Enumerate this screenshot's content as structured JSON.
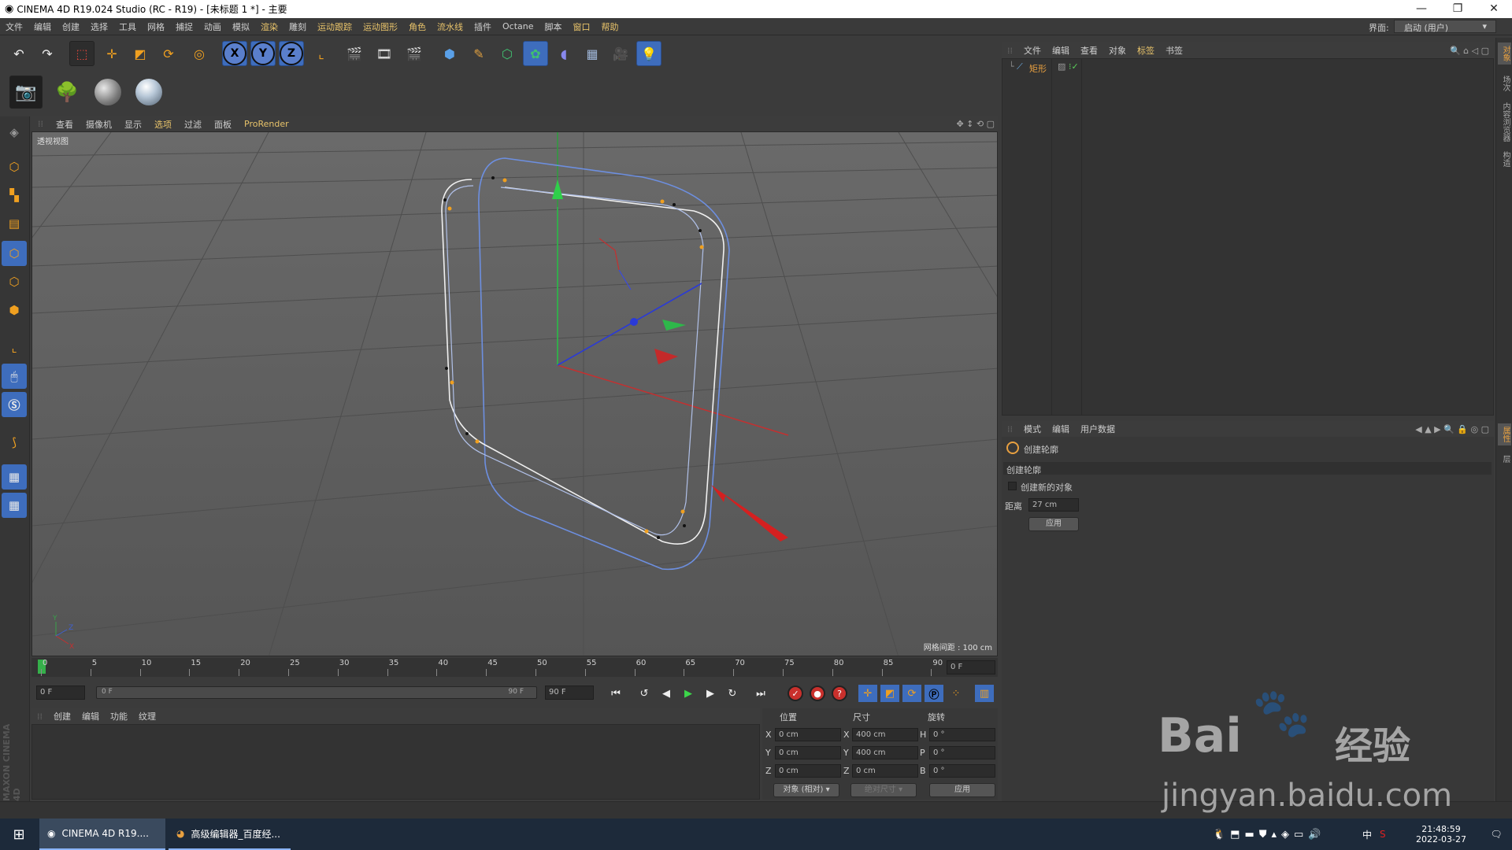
{
  "window": {
    "title": "CINEMA 4D R19.024 Studio (RC - R19) - [未标题 1 *] - 主要",
    "controls": [
      "—",
      "❐",
      "✕"
    ]
  },
  "menubar": {
    "items": [
      "文件",
      "编辑",
      "创建",
      "选择",
      "工具",
      "网格",
      "捕捉",
      "动画",
      "模拟",
      "渲染",
      "雕刻",
      "运动跟踪",
      "运动图形",
      "角色",
      "流水线",
      "插件",
      "Octane",
      "脚本",
      "窗口",
      "帮助"
    ],
    "layout_label": "界面:",
    "layout_value": "启动 (用户)"
  },
  "viewport": {
    "menu": [
      "查看",
      "摄像机",
      "显示",
      "选项",
      "过滤",
      "面板",
      "ProRender"
    ],
    "label": "透视视图",
    "grid_spacing": "网格间距 : 100 cm"
  },
  "timeline": {
    "ticks": [
      "0",
      "5",
      "10",
      "15",
      "20",
      "25",
      "30",
      "35",
      "40",
      "45",
      "50",
      "55",
      "60",
      "65",
      "70",
      "75",
      "80",
      "85",
      "90"
    ],
    "current_frame": "0 F",
    "start_field": "0 F",
    "range_start": "0 F",
    "range_end": "90 F",
    "end_field": "90 F"
  },
  "material_manager": {
    "menu": [
      "创建",
      "编辑",
      "功能",
      "纹理"
    ]
  },
  "coordinates": {
    "headers": [
      "位置",
      "尺寸",
      "旋转"
    ],
    "rows": [
      {
        "pos_label": "X",
        "pos": "0 cm",
        "size_label": "X",
        "size": "400 cm",
        "rot_label": "H",
        "rot": "0 °"
      },
      {
        "pos_label": "Y",
        "pos": "0 cm",
        "size_label": "Y",
        "size": "400 cm",
        "rot_label": "P",
        "rot": "0 °"
      },
      {
        "pos_label": "Z",
        "pos": "0 cm",
        "size_label": "Z",
        "size": "0 cm",
        "rot_label": "B",
        "rot": "0 °"
      }
    ],
    "mode": "对象 (相对)",
    "size_mode": "绝对尺寸",
    "apply": "应用"
  },
  "object_manager": {
    "menu": [
      "文件",
      "编辑",
      "查看",
      "对象",
      "标签",
      "书签"
    ],
    "object_name": "矩形"
  },
  "attribute_manager": {
    "menu": [
      "模式",
      "编辑",
      "用户数据"
    ],
    "tool_name": "创建轮廓",
    "section": "创建轮廓",
    "checkbox_label": "创建新的对象",
    "distance_label": "距离",
    "distance_value": "27 cm",
    "apply": "应用"
  },
  "right_tabs": [
    "对象",
    "场次",
    "内容浏览器",
    "构造"
  ],
  "right_tabs2": [
    "属性",
    "层"
  ],
  "taskbar": {
    "apps": [
      {
        "label": "CINEMA 4D R19...."
      },
      {
        "label": "高级编辑器_百度经..."
      }
    ],
    "time": "21:48:59",
    "date": "2022-03-27",
    "ime": "中"
  },
  "watermark": {
    "brand": "Bai",
    "brand2": "经验",
    "url": "jingyan.baidu.com"
  },
  "side_brand": "MAXON CINEMA 4D"
}
